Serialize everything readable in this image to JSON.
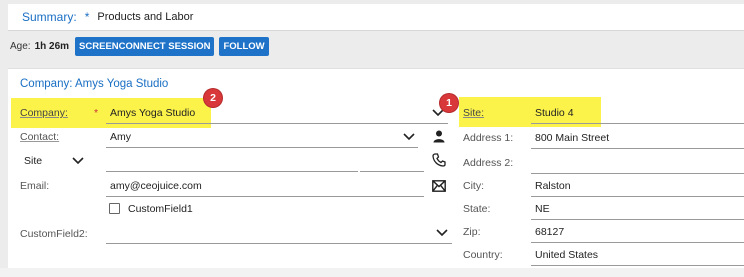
{
  "summary": {
    "label": "Summary:",
    "required_mark": "*",
    "value": "Products and Labor"
  },
  "age": {
    "label": "Age:",
    "value": "1h 26m"
  },
  "buttons": {
    "screenconnect": "SCREENCONNECT SESSION",
    "follow": "FOLLOW"
  },
  "company_card": {
    "title": "Company: Amys Yoga Studio",
    "company_label": "Company:",
    "company_required": "*",
    "company_value": "Amys Yoga Studio",
    "contact_label": "Contact:",
    "contact_value": "Amy",
    "site_select_label": "Site",
    "phone_value": "",
    "phone_ext_value": "",
    "email_label": "Email:",
    "email_value": "amy@ceojuice.com",
    "customfield1_label": "CustomField1",
    "customfield2_label": "CustomField2:",
    "customfield2_value": ""
  },
  "site_panel": {
    "site_label": "Site:",
    "site_value": "Studio 4",
    "address1_label": "Address 1:",
    "address1_value": "800 Main Street",
    "address2_label": "Address 2:",
    "address2_value": "",
    "city_label": "City:",
    "city_value": "Ralston",
    "state_label": "State:",
    "state_value": "NE",
    "zip_label": "Zip:",
    "zip_value": "68127",
    "country_label": "Country:",
    "country_value": "United States"
  },
  "annotations": {
    "badge_1": "1",
    "badge_2": "2"
  },
  "colors": {
    "accent": "#1a6fc4",
    "button": "#1e73c8",
    "highlight": "#fbf24a",
    "badge": "#d9383a"
  },
  "icons": [
    "chevron-down-icon",
    "person-icon",
    "phone-icon",
    "email-icon"
  ]
}
